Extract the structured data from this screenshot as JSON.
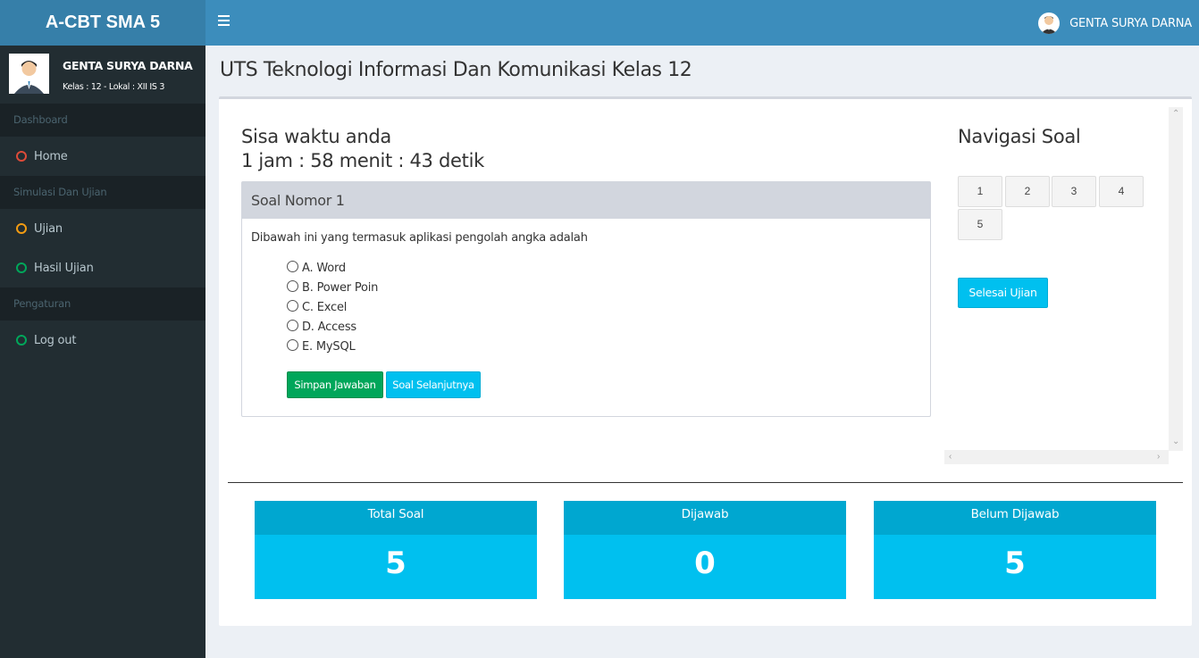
{
  "app": {
    "logo": "A-CBT SMA 5"
  },
  "topbar": {
    "user_name": "GENTA SURYA DARNA"
  },
  "sidebar": {
    "user_name": "GENTA SURYA DARNA",
    "user_meta": "Kelas : 12 - Lokal : XII IS 3",
    "sections": [
      {
        "header": "Dashboard",
        "items": [
          {
            "label": "Home",
            "icon": "circle-icon",
            "color": "#dd4b39"
          }
        ]
      },
      {
        "header": "Simulasi Dan Ujian",
        "items": [
          {
            "label": "Ujian",
            "icon": "circle-icon",
            "color": "#f39c12"
          },
          {
            "label": "Hasil Ujian",
            "icon": "circle-icon",
            "color": "#00a65a"
          }
        ]
      },
      {
        "header": "Pengaturan",
        "items": [
          {
            "label": "Log out",
            "icon": "circle-icon",
            "color": "#00a65a"
          }
        ]
      }
    ]
  },
  "page": {
    "title": "UTS Teknologi Informasi Dan Komunikasi Kelas 12"
  },
  "timer": {
    "label": "Sisa waktu anda",
    "value": "1 jam : 58 menit : 43 detik"
  },
  "question": {
    "header": "Soal Nomor 1",
    "text": "Dibawah ini yang termasuk aplikasi pengolah angka adalah",
    "options": [
      "A. Word",
      "B. Power Poin",
      "C. Excel",
      "D. Access",
      "E. MySQL"
    ],
    "save_label": "Simpan Jawaban",
    "next_label": "Soal Selanjutnya"
  },
  "navigation": {
    "title": "Navigasi Soal",
    "numbers": [
      "1",
      "2",
      "3",
      "4",
      "5"
    ],
    "finish_label": "Selesai Ujian"
  },
  "stats": [
    {
      "label": "Total Soal",
      "value": "5"
    },
    {
      "label": "Dijawab",
      "value": "0"
    },
    {
      "label": "Belum Dijawab",
      "value": "5"
    }
  ],
  "colors": {
    "header": "#3c8dbc",
    "logo": "#367fa9",
    "sidebar": "#222d32",
    "accent": "#00c0ef",
    "success": "#00a65a"
  }
}
